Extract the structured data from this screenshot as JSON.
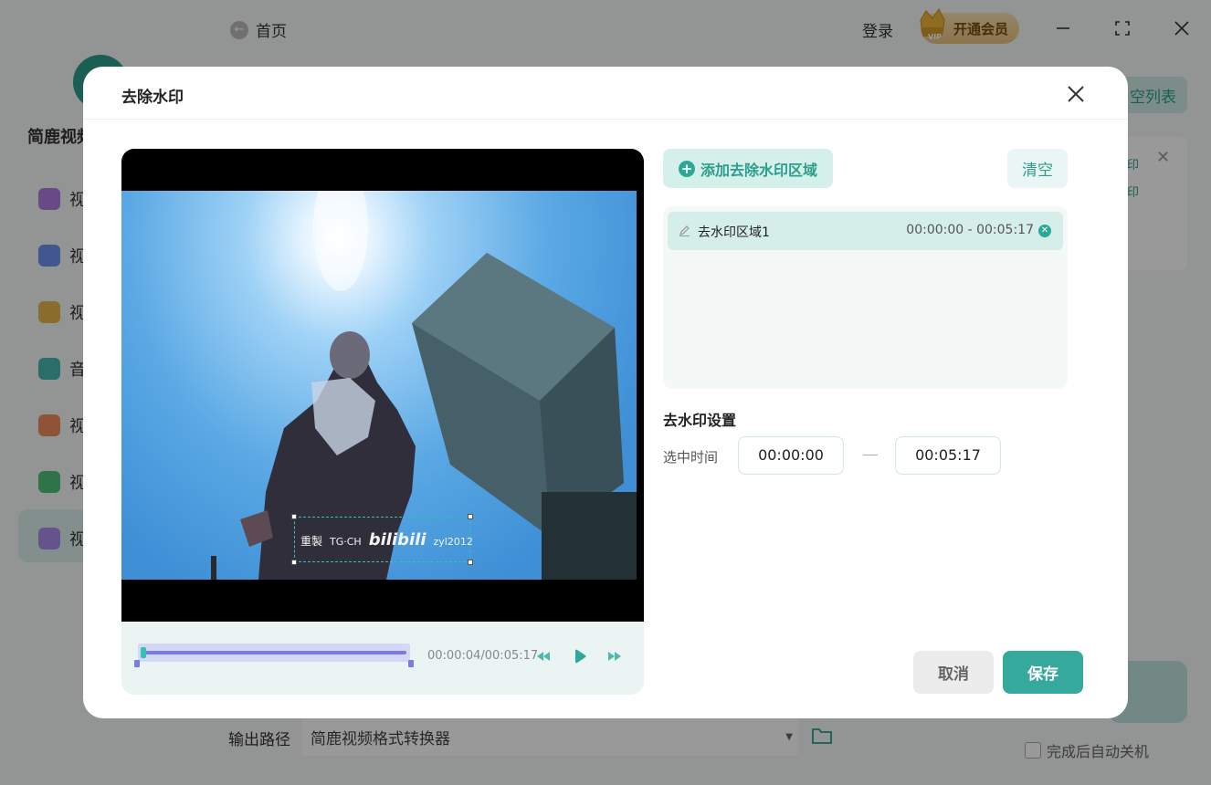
{
  "background": {
    "home_label": "首页",
    "login_label": "登录",
    "vip_label": "开通会员",
    "vip_badge": "VIP",
    "brand_partial": "简鹿视频",
    "sidebar_partial_labels": [
      "视",
      "视",
      "视",
      "音",
      "视",
      "视",
      "视"
    ],
    "sidebar_icon_colors": [
      "#b07be0",
      "#6f8ff0",
      "#e7b54b",
      "#45b8b0",
      "#ef8c5a",
      "#4fc07a",
      "#a78ce8"
    ],
    "clear_list_partial": "空列表",
    "right_card_partial": [
      "印",
      "印"
    ],
    "output_label": "输出路径",
    "output_value": "简鹿视频格式转换器",
    "auto_shutdown_label": "完成后自动关机"
  },
  "modal": {
    "title": "去除水印",
    "close_icon": "close-icon",
    "video": {
      "watermark_parts": [
        "重製",
        "TG·CH",
        "bilibili",
        "zyl2012"
      ],
      "time_readout": "00:00:04/00:05:17",
      "progress_fraction": 0.013
    },
    "add_region_label": "添加去除水印区域",
    "clear_label": "清空",
    "regions": [
      {
        "name": "去水印区域1",
        "range": "00:00:00 - 00:05:17"
      }
    ],
    "settings": {
      "title": "去水印设置",
      "selected_time_label": "选中时间",
      "start_time": "00:00:00",
      "end_time": "00:05:17"
    },
    "cancel_label": "取消",
    "save_label": "保存"
  },
  "colors": {
    "accent": "#35aa9c",
    "accent_light": "#d5efeb",
    "timeline": "#7b7be8"
  }
}
